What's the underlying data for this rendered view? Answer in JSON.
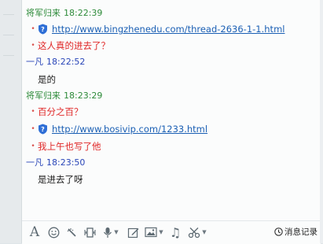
{
  "messages": [
    {
      "sender": "将军归来",
      "time": "18:22:39",
      "lines": [
        {
          "type": "link",
          "text": "http://www.bingzhenedu.com/thread-2636-1-1.html"
        },
        {
          "type": "text",
          "text": "这人真的进去了？",
          "color": "#e02626"
        }
      ]
    },
    {
      "sender": "一凡",
      "time": "18:22:52",
      "lines": [
        {
          "type": "plain",
          "text": "是的"
        }
      ]
    },
    {
      "sender": "将军归来",
      "time": "18:23:29",
      "lines": [
        {
          "type": "text",
          "text": "百分之百？",
          "color": "#e02626"
        },
        {
          "type": "link",
          "text": "http://www.bosivip.com/1233.html"
        },
        {
          "type": "text",
          "text": "我上午也写了他",
          "color": "#e02626"
        }
      ]
    },
    {
      "sender": "一凡",
      "time": "18:23:50",
      "lines": [
        {
          "type": "plain",
          "text": "是进去了呀"
        }
      ]
    }
  ],
  "toolbar": {
    "icons": [
      "font-icon",
      "emoji-icon",
      "magic-icon",
      "shake-icon",
      "voice-icon",
      "edit-image-icon",
      "image-icon",
      "music-icon",
      "screenshot-icon"
    ],
    "history_label": "消息记录"
  },
  "colors": {
    "peer": "#2e8b3a",
    "me": "#2a46b8",
    "red": "#e02626",
    "link": "#1a5fb4"
  }
}
